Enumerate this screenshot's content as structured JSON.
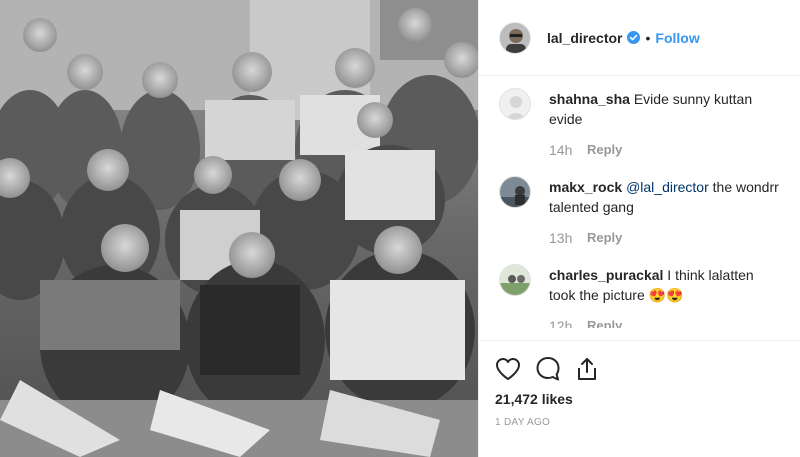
{
  "post": {
    "photo_alt": "Black and white group photo of film crew",
    "icons": [
      "photo"
    ]
  },
  "header": {
    "username": "lal_director",
    "verified_icon": "verified-badge-icon",
    "separator": "•",
    "follow_label": "Follow",
    "accent": "#3897f0"
  },
  "comments": [
    {
      "user": "shahna_sha",
      "text": "Evide sunny kuttan evide",
      "time": "14h",
      "reply_label": "Reply"
    },
    {
      "user": "makx_rock",
      "mention": "@lal_director",
      "text": " the wondrr talented gang",
      "time": "13h",
      "reply_label": "Reply"
    },
    {
      "user": "charles_purackal",
      "text": "I think lalatten took the picture 😍😍",
      "time": "12h",
      "reply_label": "Reply"
    }
  ],
  "actions": {
    "like_icon": "heart-icon",
    "comment_icon": "comment-bubble-icon",
    "share_icon": "share-icon",
    "likes": "21,472 likes",
    "date": "1 DAY AGO"
  }
}
